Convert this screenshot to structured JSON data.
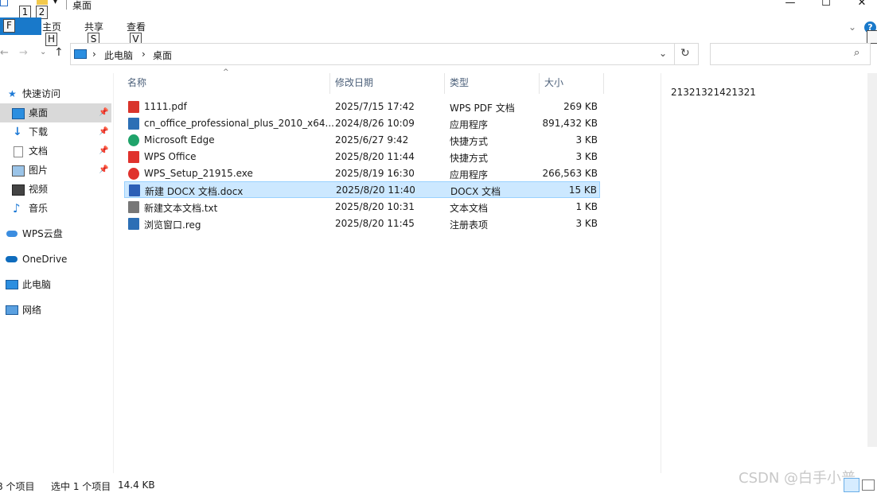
{
  "titlebar": {
    "title": "桌面",
    "keytips": [
      "1",
      "2"
    ],
    "file_key": "F"
  },
  "ribbon": {
    "tabs": [
      {
        "label": "主页",
        "key": "H"
      },
      {
        "label": "共享",
        "key": "S"
      },
      {
        "label": "查看",
        "key": "V"
      }
    ]
  },
  "address": {
    "crumbs": [
      "此电脑",
      "桌面"
    ]
  },
  "nav": {
    "items": [
      {
        "label": "快速访问",
        "icon": "star-icon"
      },
      {
        "label": "桌面",
        "icon": "desktop-icon",
        "pinned": true,
        "selected": true
      },
      {
        "label": "下载",
        "icon": "download-icon",
        "pinned": true
      },
      {
        "label": "文档",
        "icon": "document-icon",
        "pinned": true
      },
      {
        "label": "图片",
        "icon": "picture-icon",
        "pinned": true
      },
      {
        "label": "视频",
        "icon": "video-icon"
      },
      {
        "label": "音乐",
        "icon": "music-icon"
      },
      {
        "label": "WPS云盘",
        "icon": "cloud-icon"
      },
      {
        "label": "OneDrive",
        "icon": "onedrive-icon"
      },
      {
        "label": "此电脑",
        "icon": "computer-icon"
      },
      {
        "label": "网络",
        "icon": "network-icon"
      }
    ]
  },
  "columns": {
    "name": "名称",
    "date": "修改日期",
    "type": "类型",
    "size": "大小"
  },
  "files": [
    {
      "name": "1111.pdf",
      "date": "2025/7/15 17:42",
      "type": "WPS PDF 文档",
      "size": "269 KB",
      "icon": "pdf-icon",
      "color": "#d9342b"
    },
    {
      "name": "cn_office_professional_plus_2010_x64...",
      "date": "2024/8/26 10:09",
      "type": "应用程序",
      "size": "891,432 KB",
      "icon": "installer-icon",
      "color": "#2c6fb5"
    },
    {
      "name": "Microsoft Edge",
      "date": "2025/6/27 9:42",
      "type": "快捷方式",
      "size": "3 KB",
      "icon": "edge-icon",
      "color": "#1fa36a"
    },
    {
      "name": "WPS Office",
      "date": "2025/8/20 11:44",
      "type": "快捷方式",
      "size": "3 KB",
      "icon": "wps-icon",
      "color": "#e0322d"
    },
    {
      "name": "WPS_Setup_21915.exe",
      "date": "2025/8/19 16:30",
      "type": "应用程序",
      "size": "266,563 KB",
      "icon": "wps-setup-icon",
      "color": "#e0322d"
    },
    {
      "name": "新建 DOCX 文档.docx",
      "date": "2025/8/20 11:40",
      "type": "DOCX 文档",
      "size": "15 KB",
      "icon": "word-icon",
      "color": "#2b5fb6",
      "selected": true
    },
    {
      "name": "新建文本文档.txt",
      "date": "2025/8/20 10:31",
      "type": "文本文档",
      "size": "1 KB",
      "icon": "text-file-icon",
      "color": "#777777"
    },
    {
      "name": "浏览窗口.reg",
      "date": "2025/8/20 11:45",
      "type": "注册表项",
      "size": "3 KB",
      "icon": "registry-icon",
      "color": "#2c6fb5"
    }
  ],
  "preview": {
    "text": "21321321421321"
  },
  "status": {
    "count": "8 个项目",
    "selection": "选中 1 个项目",
    "size": "14.4 KB",
    "watermark": "CSDN @白手小普"
  }
}
